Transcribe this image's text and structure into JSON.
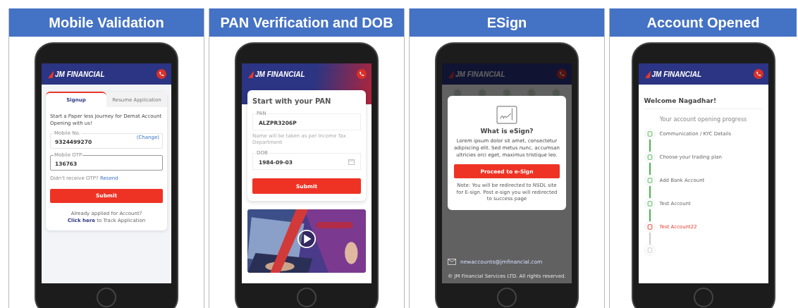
{
  "panels": [
    {
      "kind": "signup",
      "heading": "Mobile Validation",
      "brand": "JM FINANCIAL",
      "tabs": [
        {
          "label": "Signup",
          "selected": true
        },
        {
          "label": "Resume Application",
          "selected": false
        }
      ],
      "intro": "Start a Paper less Journey for Demat Account Opening with us!",
      "fields": [
        {
          "label": "Mobile No.",
          "value": "9324499270",
          "action": "(Change)",
          "focused": false
        },
        {
          "label": "Mobile OTP",
          "value": "136763",
          "focused": true
        }
      ],
      "resend_prompt": "Didn't receive OTP?",
      "resend_link": "Resend",
      "submit": "Submit",
      "footer_question": "Already applied for Account?",
      "track_link": "Click here",
      "track_text": "to Track Application"
    },
    {
      "kind": "pan",
      "heading": "PAN Verification and DOB",
      "brand": "JM FINANCIAL",
      "title": "Start with your PAN",
      "fields": [
        {
          "label": "PAN",
          "value": "ALZPR3206P",
          "hint": "Name will be taken as per Income Tax Department"
        },
        {
          "label": "DOB",
          "value": "1984-09-03",
          "calendar": true
        }
      ],
      "submit": "Submit"
    },
    {
      "kind": "esign",
      "heading": "ESign",
      "brand": "JM FINANCIAL",
      "email": "newaccounts@jmfinancial.com",
      "copyright": "© JM Financial Services LTD. All rights reserved.",
      "modal": {
        "title": "What is eSign?",
        "body": "Lorem ipsum dolor sit amet, consectetur adipiscing elit. Sed metus nunc, accumsan ultricies orci eget, maximus tristique leo.",
        "button": "Proceed to e-Sign",
        "note": "Note: You will be redirected to NSDL site for E-sign. Post e-sign you will redirected to success page"
      }
    },
    {
      "kind": "progress",
      "heading": "Account Opened",
      "brand": "JM FINANCIAL",
      "welcome": "Welcome Nagadhar!",
      "subtitle": "Your account opening progress",
      "steps": [
        {
          "label": "Communication / KYC Details",
          "completed": true,
          "active": false
        },
        {
          "label": "Choose your trading plan",
          "completed": true,
          "active": false
        },
        {
          "label": "Add Bank Account",
          "completed": true,
          "active": false
        },
        {
          "label": "Test Account",
          "completed": true,
          "active": false
        },
        {
          "label": "Test Account22",
          "completed": false,
          "active": true
        },
        {
          "completed": false,
          "active": false
        }
      ]
    }
  ]
}
